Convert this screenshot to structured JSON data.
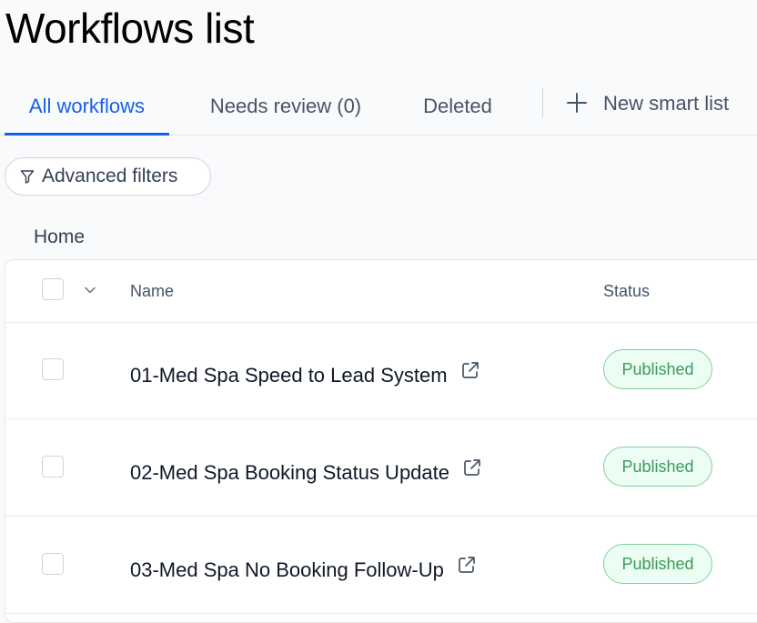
{
  "page": {
    "title": "Workflows list"
  },
  "tabs": [
    {
      "label": "All workflows",
      "active": true
    },
    {
      "label": "Needs review (0)",
      "active": false
    },
    {
      "label": "Deleted",
      "active": false
    }
  ],
  "new_smart_list": {
    "label": "New smart list",
    "icon": "plus-icon"
  },
  "filters": {
    "label": "Advanced filters",
    "icon": "filter-icon"
  },
  "breadcrumb": {
    "label": "Home"
  },
  "table": {
    "columns": {
      "name": "Name",
      "status": "Status"
    },
    "rows": [
      {
        "name": "01-Med Spa Speed to Lead System",
        "status": "Published"
      },
      {
        "name": "02-Med Spa Booking Status Update",
        "status": "Published"
      },
      {
        "name": "03-Med Spa No Booking Follow-Up",
        "status": "Published"
      }
    ]
  },
  "colors": {
    "accent": "#155eef",
    "published_text": "#3d9a5a",
    "published_bg": "#ecfdf3",
    "published_border": "#86cf9b"
  }
}
